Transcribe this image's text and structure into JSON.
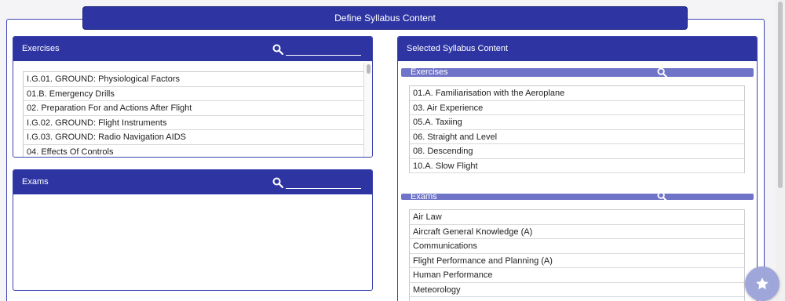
{
  "page": {
    "title": "Define Syllabus Content"
  },
  "left": {
    "exercises": {
      "title": "Exercises",
      "search_value": "",
      "items": [
        "I.G.01. GROUND: Physiological Factors",
        "01.B. Emergency Drills",
        "02. Preparation For and Actions After Flight",
        "I.G.02. GROUND: Flight Instruments",
        "I.G.03. GROUND: Radio Navigation AIDS",
        "04. Effects Of Controls"
      ]
    },
    "exams": {
      "title": "Exams",
      "search_value": ""
    }
  },
  "right": {
    "title": "Selected Syllabus Content",
    "exercises": {
      "title": "Exercises",
      "items": [
        "01.A. Familiarisation with the Aeroplane",
        "03. Air Experience",
        "05.A. Taxiing",
        "06. Straight and Level",
        "08. Descending",
        "10.A. Slow Flight"
      ]
    },
    "exams": {
      "title": "Exams",
      "items": [
        "Air Law",
        "Aircraft General Knowledge (A)",
        "Communications",
        "Flight Performance and Planning (A)",
        "Human Performance",
        "Meteorology"
      ]
    }
  },
  "colors": {
    "header": "#2e35a3",
    "subbar": "#6f74c8",
    "fab": "#9fa6da"
  },
  "icons": {
    "search": "search-icon",
    "favorite": "star-icon"
  }
}
